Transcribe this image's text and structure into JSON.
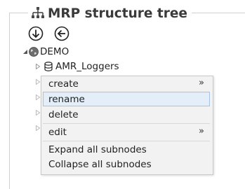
{
  "panel": {
    "title": "MRP structure tree"
  },
  "navigation": {
    "down_icon": "arrow-down-circle-icon",
    "back_icon": "arrow-left-circle-icon"
  },
  "tree": {
    "root": {
      "label": "DEMO",
      "icon": "globe-icon",
      "expanded": true
    },
    "child": {
      "label": "AMR_Loggers",
      "icon": "database-icon",
      "expanded": false
    }
  },
  "context_menu": {
    "items": [
      {
        "label": "create",
        "submenu": true,
        "submenu_glyph": "»"
      },
      {
        "label": "rename",
        "submenu": false,
        "highlighted": true
      },
      {
        "label": "delete",
        "submenu": false
      },
      {
        "label": "edit",
        "submenu": true,
        "submenu_glyph": "»"
      },
      {
        "label": "Expand all subnodes",
        "submenu": false
      },
      {
        "label": "Collapse all subnodes",
        "submenu": false
      }
    ]
  },
  "colors": {
    "menu_background": "#f2f2f2",
    "highlight_background": "#e4eef8",
    "highlight_border": "#a6c3e3"
  }
}
